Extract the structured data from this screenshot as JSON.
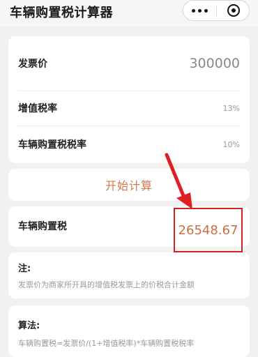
{
  "header": {
    "title": "车辆购置税计算器"
  },
  "inputs": {
    "invoice_price": {
      "label": "发票价",
      "value": "300000"
    },
    "vat_rate": {
      "label": "增值税率",
      "value": "13%"
    },
    "purchase_tax_rate": {
      "label": "车辆购置税税率",
      "value": "10%"
    }
  },
  "actions": {
    "calculate_label": "开始计算"
  },
  "result": {
    "label": "车辆购置税",
    "value": "26548.67"
  },
  "note": {
    "title": "注:",
    "text": "发票价为商家所开具的增值税发票上的价税合计金额"
  },
  "formula": {
    "title": "算法:",
    "text": "车辆购置税=发票价/(1+增值税率)*车辆购置税税率"
  },
  "colors": {
    "accent": "#d2794a",
    "highlight": "#cc2222",
    "background": "#f2f1f0"
  },
  "icons": {
    "more": "more-dots-icon",
    "close": "target-circle-icon",
    "annotation": "red-arrow-icon"
  }
}
